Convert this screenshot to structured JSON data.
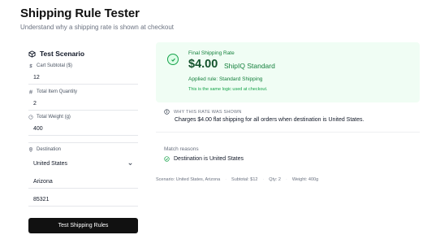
{
  "header": {
    "title": "Shipping Rule Tester",
    "subtitle": "Understand why a shipping rate is shown at checkout"
  },
  "scenario": {
    "heading": "Test Scenario",
    "cart_subtotal": {
      "label": "Cart Subtotal ($)",
      "value": "12"
    },
    "total_quantity": {
      "label": "Total Item Quantity",
      "value": "2"
    },
    "total_weight": {
      "label": "Total Weight (g)",
      "value": "400"
    },
    "destination": {
      "label": "Destination",
      "country": "United States",
      "state": "Arizona",
      "zip": "85321"
    },
    "test_button": "Test Shipping Rules"
  },
  "result": {
    "label": "Final Shipping Rate",
    "price": "$4.00",
    "carrier": "ShipIQ Standard",
    "applied_rule": "Applied rule: Standard Shipping",
    "note": "This is the same logic used at checkout.",
    "accent": "#16a34a"
  },
  "why": {
    "heading": "WHY THIS RATE WAS SHOWN",
    "text": "Charges $4.00 flat shipping for all orders when destination is United States."
  },
  "match": {
    "title": "Match reasons",
    "reasons": [
      "Destination is United States"
    ]
  },
  "summary": {
    "scenario": "Scenario: United States, Arizona",
    "subtotal": "Subtotal: $12",
    "qty": "Qty: 2",
    "weight": "Weight: 400g"
  }
}
